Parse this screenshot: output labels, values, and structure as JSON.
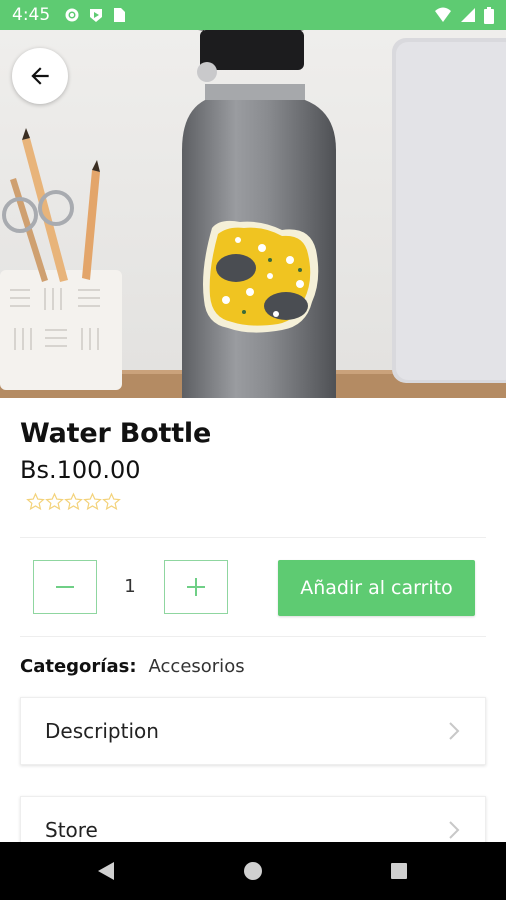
{
  "status": {
    "time": "4:45"
  },
  "product": {
    "name": "Water Bottle",
    "price": "Bs.100.00",
    "rating": 0,
    "rating_max": 5
  },
  "quantity": {
    "value": "1",
    "decrement_icon": "minus-icon",
    "increment_icon": "plus-icon"
  },
  "cart": {
    "add_label": "Añadir al carrito"
  },
  "categories": {
    "label": "Categorías:",
    "value": "Accesorios"
  },
  "sections": [
    {
      "label": "Description"
    },
    {
      "label": "Store"
    }
  ],
  "colors": {
    "accent": "#5ecb72",
    "star": "#f3d27a",
    "nav": "#000000"
  }
}
